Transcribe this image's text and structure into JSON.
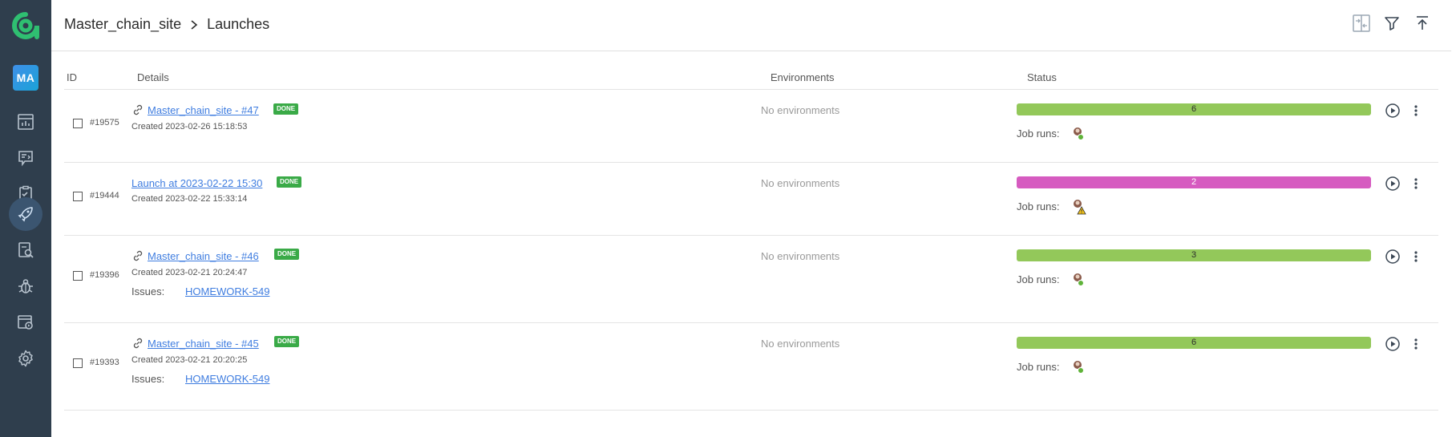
{
  "sidebar": {
    "project_badge": "MA",
    "items": [
      {
        "name": "dashboards-icon",
        "active": false
      },
      {
        "name": "test-cases-icon",
        "active": false
      },
      {
        "name": "test-plans-icon",
        "active": false
      },
      {
        "name": "launches-icon",
        "active": true
      },
      {
        "name": "analytics-icon",
        "active": false
      },
      {
        "name": "defects-icon",
        "active": false
      },
      {
        "name": "jobs-icon",
        "active": false
      },
      {
        "name": "settings-icon",
        "active": false
      }
    ]
  },
  "header": {
    "project_name": "Master_chain_site",
    "page_title": "Launches",
    "actions": [
      "compare-icon",
      "filter-icon",
      "upload-icon"
    ]
  },
  "table": {
    "columns": {
      "id": "ID",
      "details": "Details",
      "environments": "Environments",
      "status": "Status"
    },
    "rows": [
      {
        "id": "#19575",
        "title": "Master_chain_site - #47",
        "has_link_icon": true,
        "badge": "DONE",
        "created": "Created 2023-02-26 15:18:53",
        "issues_label": "",
        "issue": "",
        "environments": "No environments",
        "status_value": "6",
        "status_color": "#93c85a",
        "job_runs_label": "Job runs:",
        "job_status": "passed"
      },
      {
        "id": "#19444",
        "title": "Launch at 2023-02-22 15:30",
        "has_link_icon": false,
        "badge": "DONE",
        "created": "Created 2023-02-22 15:33:14",
        "issues_label": "",
        "issue": "",
        "environments": "No environments",
        "status_value": "2",
        "status_color": "#d65bc0",
        "job_runs_label": "Job runs:",
        "job_status": "warning"
      },
      {
        "id": "#19396",
        "title": "Master_chain_site - #46",
        "has_link_icon": true,
        "badge": "DONE",
        "created": "Created 2023-02-21 20:24:47",
        "issues_label": "Issues:",
        "issue": "HOMEWORK-549",
        "environments": "No environments",
        "status_value": "3",
        "status_color": "#93c85a",
        "job_runs_label": "Job runs:",
        "job_status": "passed"
      },
      {
        "id": "#19393",
        "title": "Master_chain_site - #45",
        "has_link_icon": true,
        "badge": "DONE",
        "created": "Created 2023-02-21 20:20:25",
        "issues_label": "Issues:",
        "issue": "HOMEWORK-549",
        "environments": "No environments",
        "status_value": "6",
        "status_color": "#93c85a",
        "job_runs_label": "Job runs:",
        "job_status": "passed"
      }
    ]
  },
  "colors": {
    "sidebar_bg": "#2f3e4d",
    "link": "#3f7de0",
    "done_badge": "#3aaa47",
    "passed": "#93c85a",
    "failed": "#d65bc0",
    "logo": "#2fbf71"
  }
}
